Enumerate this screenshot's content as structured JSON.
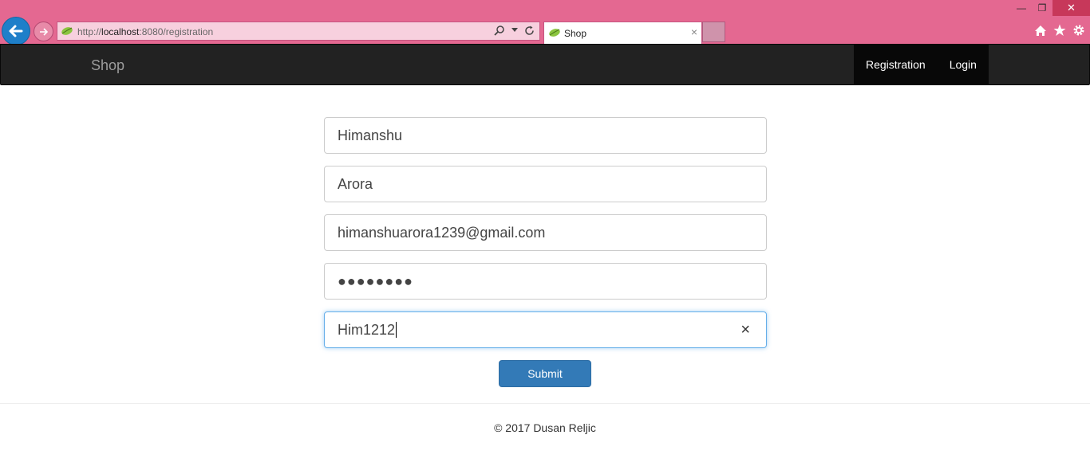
{
  "browser": {
    "url_prefix": "http://",
    "url_host": "localhost",
    "url_path": ":8080/registration",
    "tab_title": "Shop",
    "tab_close": "×",
    "colors": {
      "chrome": "#e46891",
      "back_button": "#1e7fc9"
    }
  },
  "navbar": {
    "brand": "Shop",
    "links": [
      "Registration",
      "Login"
    ]
  },
  "form": {
    "first_name": "Himanshu",
    "last_name": "Arora",
    "email": "himanshuarora1239@gmail.com",
    "password_mask": "●●●●●●●●",
    "confirm_value": "Him1212",
    "clear_icon": "×",
    "submit_label": "Submit"
  },
  "footer": {
    "text": "© 2017 Dusan Reljic"
  }
}
